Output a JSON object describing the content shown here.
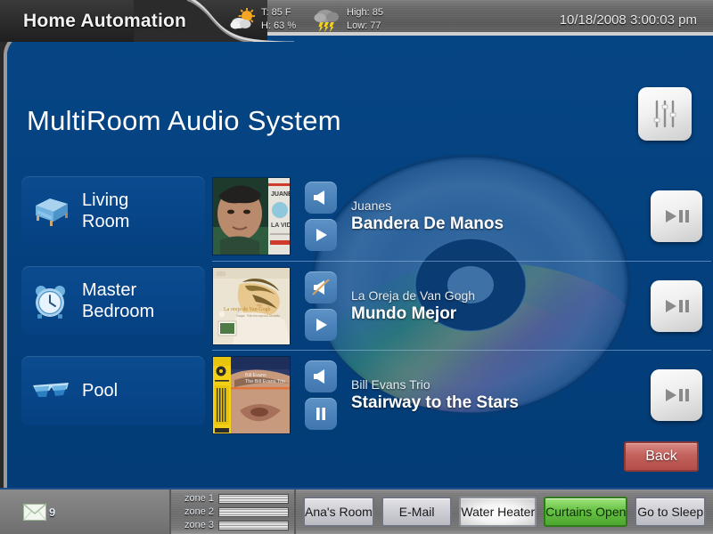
{
  "header": {
    "title": "Home Automation",
    "weather_now": {
      "icon": "sun-cloud-icon",
      "temp": "T:  85 F",
      "humidity": "H: 63 %"
    },
    "weather_forecast": {
      "icon": "storm-cloud-icon",
      "high": "High: 85",
      "low": "Low: 77"
    },
    "clock": "10/18/2008 3:00:03 pm"
  },
  "page": {
    "title": "MultiRoom Audio System",
    "eq_button_icon": "sliders-icon",
    "back_label": "Back"
  },
  "rooms": [
    {
      "label": "Living\nRoom",
      "icon": "sofa-icon"
    },
    {
      "label": "Master\nBedroom",
      "icon": "alarm-clock-icon"
    },
    {
      "label": "Pool",
      "icon": "sunglasses-icon"
    }
  ],
  "tracks": [
    {
      "artist": "Juanes",
      "song": "Bandera De Manos",
      "volume_icon": "speaker-on-icon",
      "transport_icon": "play-icon",
      "big_button_icon": "play-pause-icon",
      "art": "juanes-la-vida-cover"
    },
    {
      "artist": "La Oreja de Van Gogh",
      "song": "Mundo Mejor",
      "volume_icon": "speaker-mute-icon",
      "transport_icon": "play-icon",
      "big_button_icon": "play-pause-icon",
      "art": "la-oreja-de-van-gogh-cover"
    },
    {
      "artist": "Bill Evans Trio",
      "song": "Stairway to the Stars",
      "volume_icon": "speaker-on-icon",
      "transport_icon": "pause-icon",
      "big_button_icon": "play-pause-icon",
      "art": "bill-evans-trio-cover"
    }
  ],
  "statusbar": {
    "mail_icon": "envelope-icon",
    "mail_count": "9",
    "zones": [
      {
        "label": "zone 1"
      },
      {
        "label": "zone 2"
      },
      {
        "label": "zone 3"
      }
    ],
    "buttons": [
      {
        "label": "Ana's Room",
        "state": "normal"
      },
      {
        "label": "E-Mail",
        "state": "normal"
      },
      {
        "label": "Water Heater",
        "state": "lit"
      },
      {
        "label": "Curtains Open",
        "state": "green"
      },
      {
        "label": "Go to Sleep",
        "state": "normal"
      }
    ]
  },
  "colors": {
    "panel_blue": "#04417f",
    "accent_button_blue": "#4b82ba",
    "back_red": "#c3615c",
    "active_green": "#68c246"
  }
}
